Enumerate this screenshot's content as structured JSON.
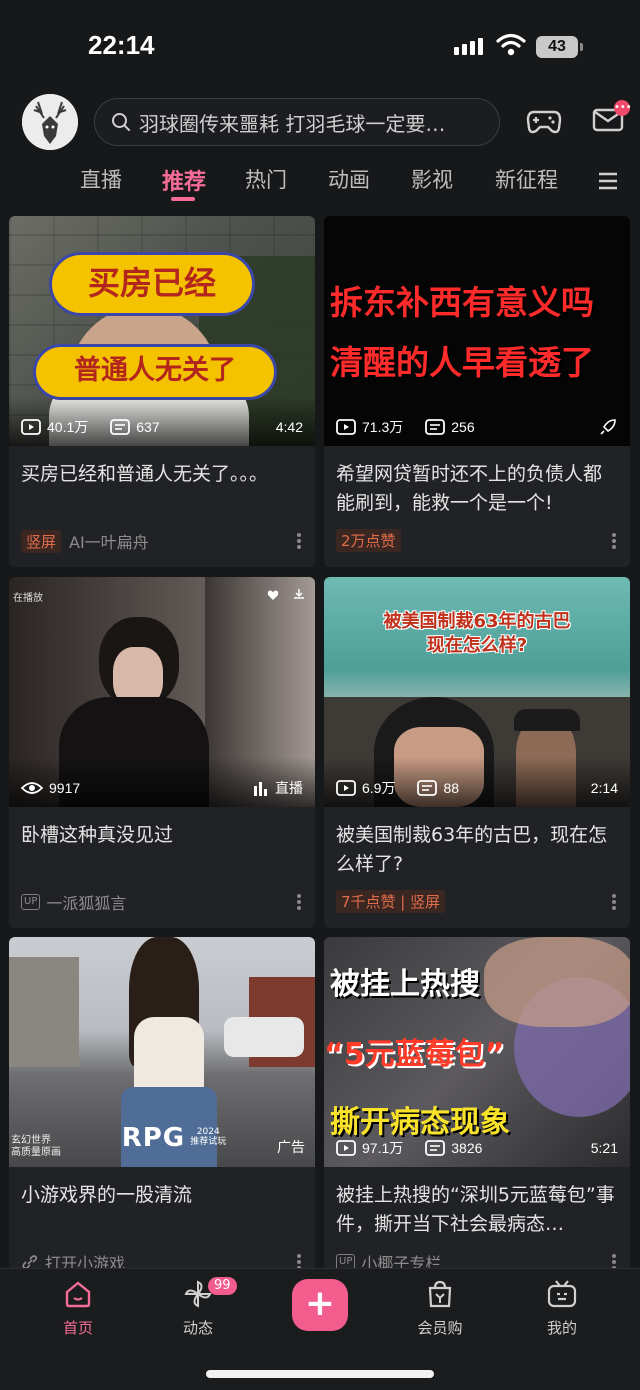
{
  "status_bar": {
    "time": "22:14",
    "battery": "43"
  },
  "header": {
    "search_placeholder": "羽球圈传来噩耗 打羽毛球一定要…",
    "icons": [
      "search-icon",
      "gamepad-icon",
      "mail-icon"
    ]
  },
  "tabs": [
    {
      "label": "直播"
    },
    {
      "label": "推荐",
      "active": true
    },
    {
      "label": "热门"
    },
    {
      "label": "动画"
    },
    {
      "label": "影视"
    },
    {
      "label": "新征程"
    }
  ],
  "cards": [
    {
      "thumb_text": [
        "买房已经",
        "普通人无关了"
      ],
      "views": "40.1万",
      "comments": "637",
      "duration": "4:42",
      "title": "买房已经和普通人无关了。。。",
      "tag": "竖屏",
      "author": "AI一叶扁舟"
    },
    {
      "thumb_text": [
        "拆东补西有意义吗",
        "清醒的人早看透了"
      ],
      "views": "71.3万",
      "comments": "256",
      "title": "希望网贷暂时还不上的负债人都能刷到，能救一个是一个!",
      "tag": "2万点赞"
    },
    {
      "thumb_overlay": "在播放",
      "views": "9917",
      "live_label": "直播",
      "title": "卧槽这种真没见过",
      "author": "一派狐狐言"
    },
    {
      "thumb_text": [
        "被美国制裁63年的古巴",
        "现在怎么样?"
      ],
      "views": "6.9万",
      "comments": "88",
      "duration": "2:14",
      "title": "被美国制裁63年的古巴，现在怎么样了?",
      "tag": "7千点赞 | 竖屏"
    },
    {
      "thumb_text": [
        "玄幻世界",
        "高质量原画",
        "RPG",
        "2024",
        "推荐试玩"
      ],
      "ad_label": "广告",
      "title": "小游戏界的一股清流",
      "author": "打开小游戏"
    },
    {
      "thumb_text": [
        "被挂上热搜",
        "“5元蓝莓包”",
        "撕开病态现象"
      ],
      "views": "97.1万",
      "comments": "3826",
      "duration": "5:21",
      "title": "被挂上热搜的“深圳5元蓝莓包”事件，撕开当下社会最病态…",
      "author": "小椰子专栏"
    }
  ],
  "bottom_nav": [
    {
      "label": "首页",
      "icon": "home-icon",
      "active": true
    },
    {
      "label": "动态",
      "icon": "pinwheel-icon",
      "badge": "99"
    },
    {
      "label": "+",
      "icon": "plus-icon"
    },
    {
      "label": "会员购",
      "icon": "shopping-bag-icon"
    },
    {
      "label": "我的",
      "icon": "tv-face-icon"
    }
  ],
  "colors": {
    "accent": "#f56d97",
    "background": "#17181a",
    "card": "#212225",
    "tag_orange": "#e06c4a"
  }
}
